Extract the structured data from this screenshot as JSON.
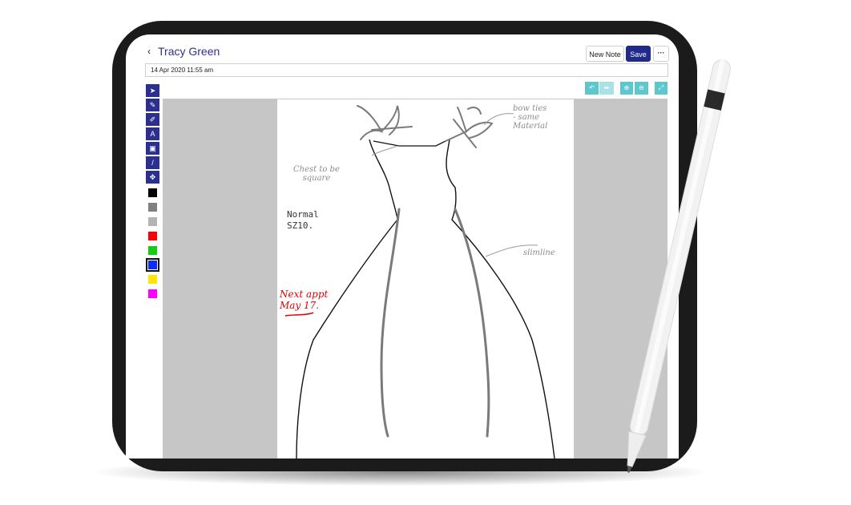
{
  "header": {
    "back_icon": "‹",
    "title": "Tracy Green",
    "new_note_label": "New Note",
    "save_label": "Save",
    "more_label": "···"
  },
  "date_field": {
    "value": "14 Apr 2020 11:55 am"
  },
  "tools": [
    {
      "name": "select-tool",
      "icon": "pointer-icon",
      "glyph": "➤"
    },
    {
      "name": "pen-tool",
      "icon": "pen-icon",
      "glyph": "✎"
    },
    {
      "name": "eraser-tool",
      "icon": "eraser-icon",
      "glyph": "✐"
    },
    {
      "name": "text-tool",
      "icon": "text-icon",
      "glyph": "A"
    },
    {
      "name": "image-tool",
      "icon": "image-icon",
      "glyph": "▣"
    },
    {
      "name": "line-tool",
      "icon": "line-icon",
      "glyph": "/"
    },
    {
      "name": "move-tool",
      "icon": "move-icon",
      "glyph": "✥"
    }
  ],
  "colors": [
    {
      "name": "black",
      "hex": "#000000"
    },
    {
      "name": "dark-gray",
      "hex": "#808080"
    },
    {
      "name": "light-gray",
      "hex": "#b4b4b4"
    },
    {
      "name": "red",
      "hex": "#ff0000"
    },
    {
      "name": "green",
      "hex": "#13cc13"
    },
    {
      "name": "blue",
      "hex": "#0a2cff",
      "selected": true
    },
    {
      "name": "yellow",
      "hex": "#ffe500"
    },
    {
      "name": "magenta",
      "hex": "#ff00ff"
    }
  ],
  "canvas_buttons": [
    "undo-icon",
    "redo-icon",
    "zoom-in-icon",
    "zoom-out-icon",
    "fullscreen-icon"
  ],
  "annotations": {
    "bow_ties": "bow ties\n- same\nMaterial",
    "chest": "Chest to be\nsquare",
    "normal": "Normal\nSZ10.",
    "next_appt": "Next appt\nMay 17.",
    "slimline": "slimline"
  },
  "accent_colors": {
    "navy": "#2b2f8f",
    "teal": "#5ec7ce"
  }
}
